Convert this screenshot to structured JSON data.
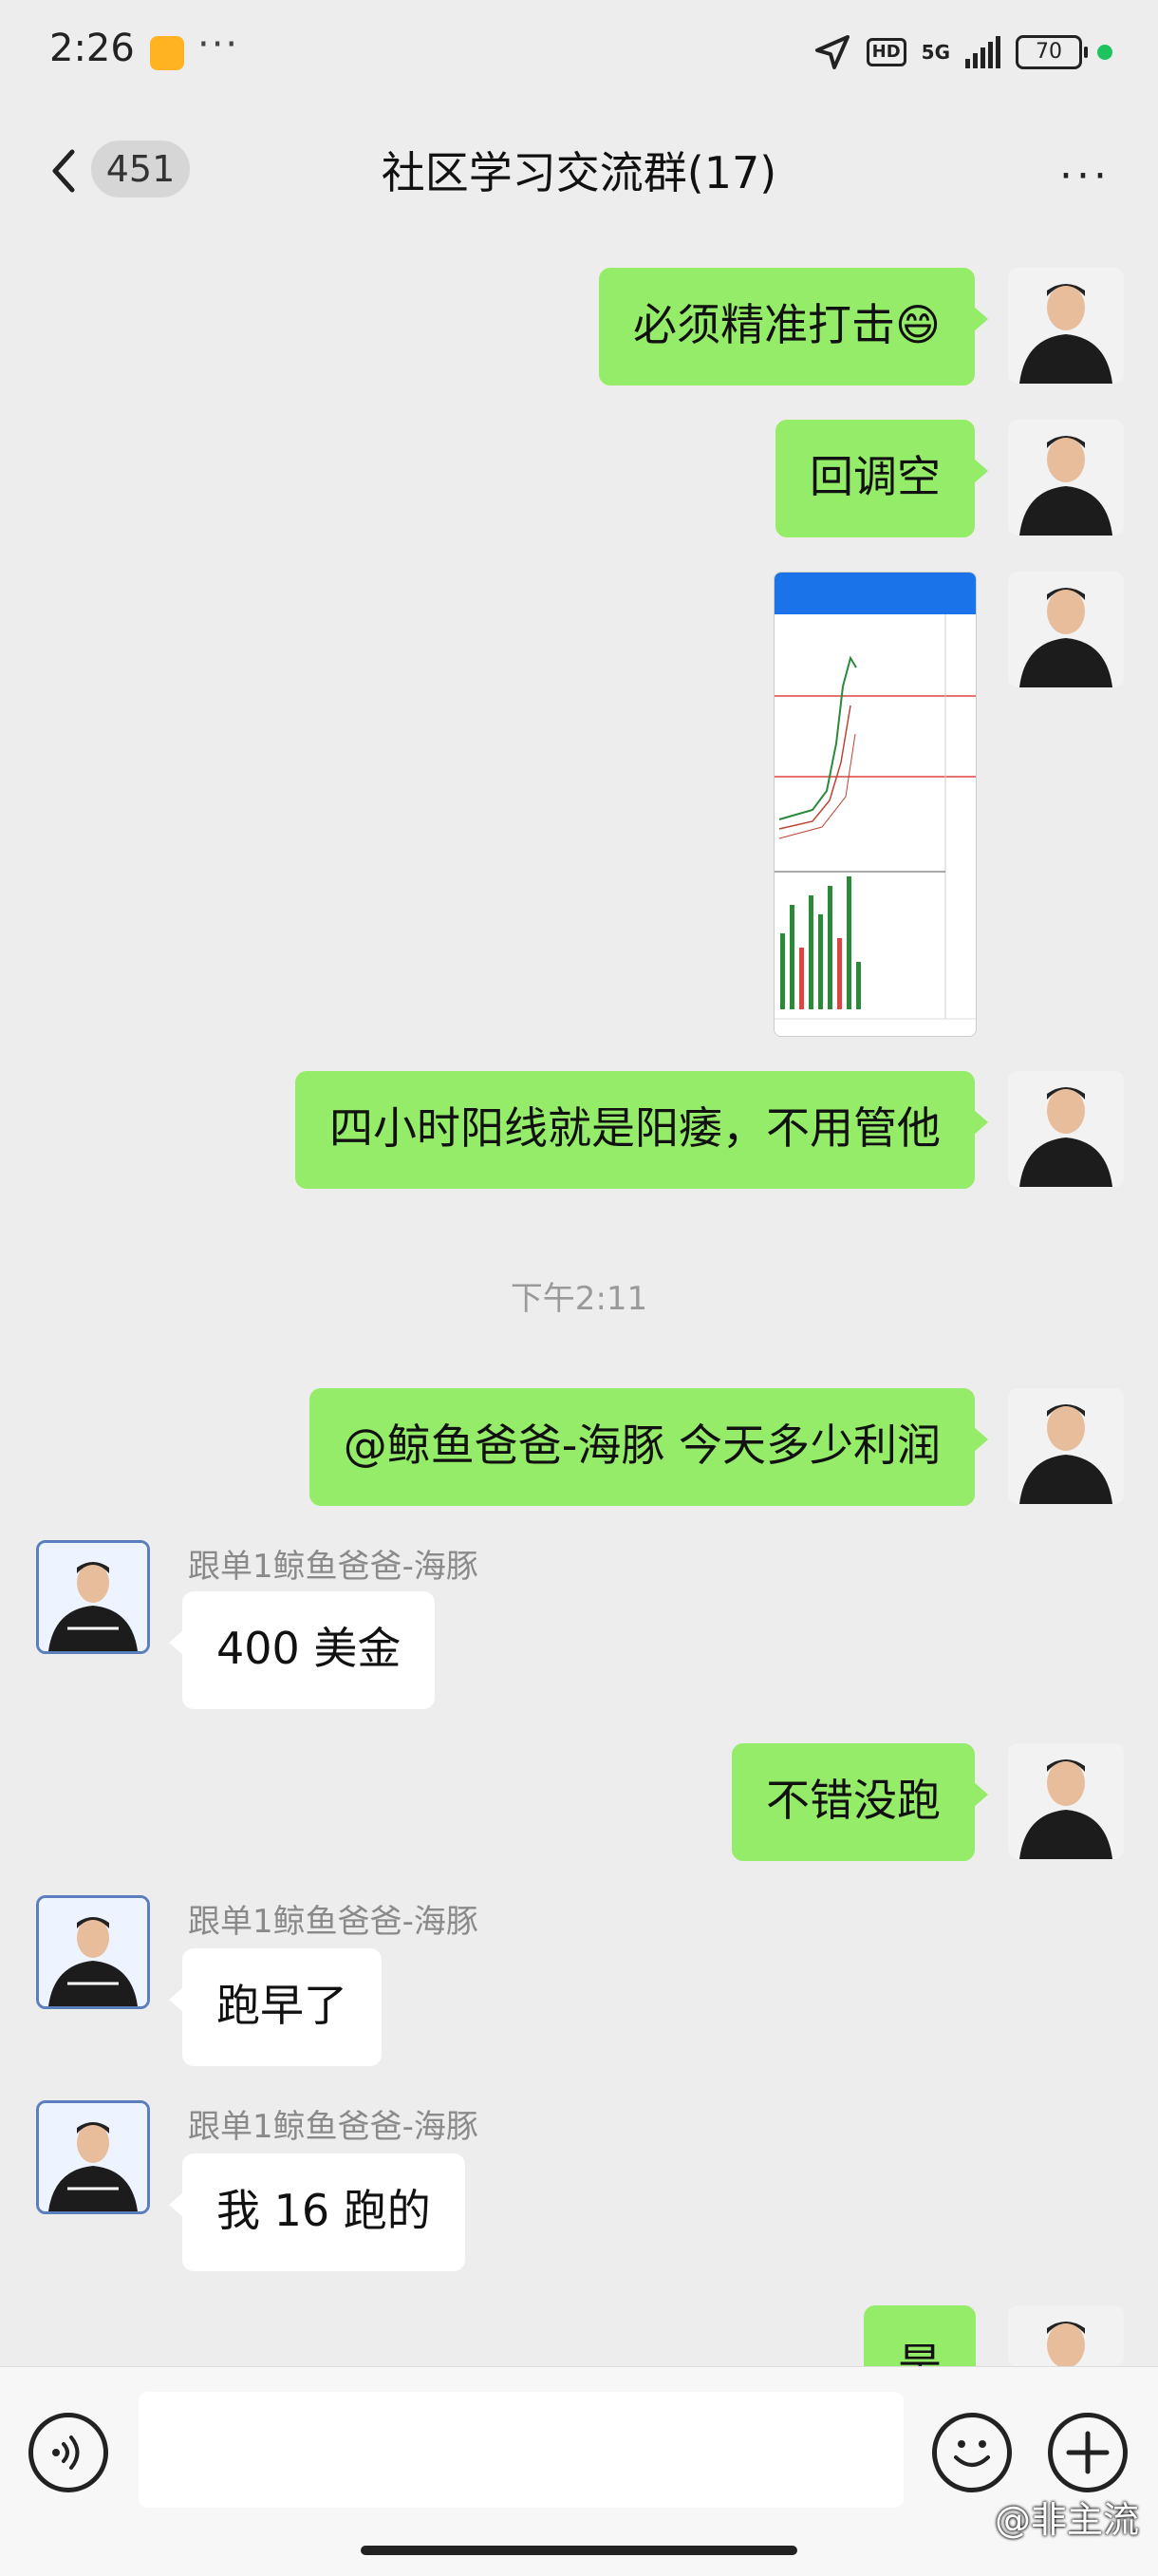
{
  "status_bar": {
    "time": "2:26",
    "more": "···",
    "hd": "HD",
    "net": "5G",
    "battery": "70"
  },
  "header": {
    "back_count": "451",
    "title": "社区学习交流群(17)",
    "more": "···"
  },
  "messages": [
    {
      "side": "me",
      "text": "必须精准打击😄"
    },
    {
      "side": "me",
      "text": "回调空"
    },
    {
      "side": "me",
      "type": "image"
    },
    {
      "side": "me",
      "text": "四小时阳线就是阳痿，不用管他"
    },
    {
      "type": "time",
      "text": "下午2:11"
    },
    {
      "side": "me",
      "text": "@鲸鱼爸爸-海豚  今天多少利润"
    },
    {
      "side": "them",
      "sender": "跟单1鲸鱼爸爸-海豚",
      "text": "400 美金"
    },
    {
      "side": "me",
      "text": "不错没跑"
    },
    {
      "side": "them",
      "sender": "跟单1鲸鱼爸爸-海豚",
      "text": "跑早了"
    },
    {
      "side": "them",
      "sender": "跟单1鲸鱼爸爸-海豚",
      "text": "我 16 跑的"
    },
    {
      "side": "me",
      "text": "是"
    }
  ],
  "bottom": {
    "watermark": "@非主流"
  }
}
